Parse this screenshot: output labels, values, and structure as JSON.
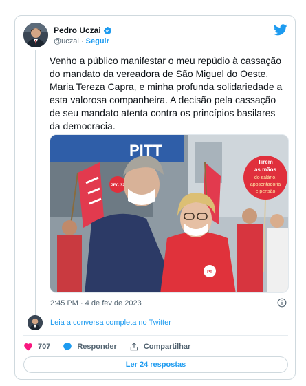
{
  "author": {
    "name": "Pedro Uczai",
    "handle": "@uczai",
    "follow_label": "Seguir",
    "separator": " · "
  },
  "tweet": {
    "text": "Venho a público manifestar o meu repúdio à cassação do mandato da vereadora de São Miguel do Oeste, Maria Tereza Capra, e minha profunda solidariedade a esta valorosa companheira. A decisão pela cassação de seu mandato atenta contra os princípios basilares da democracia.",
    "timestamp": "2:45 PM · 4 de fev de 2023"
  },
  "photo": {
    "sign_text": "PITT",
    "placard_lines": [
      "Tirem",
      "as mãos",
      "do salário,",
      "aposentadoria",
      "e pensão"
    ],
    "small_sign": "PEC 32",
    "badge": "PT"
  },
  "read_conversation": "Leia a conversa completa no Twitter",
  "actions": {
    "likes": "707",
    "reply_label": "Responder",
    "share_label": "Compartilhar"
  },
  "read_replies_label": "Ler 24 respostas",
  "colors": {
    "accent": "#1d9bf0",
    "like": "#f91880",
    "text": "#0f1419",
    "muted": "#536471",
    "border": "#cfd9de"
  },
  "icons": [
    "verified-badge-icon",
    "twitter-bird-icon",
    "info-icon",
    "heart-icon",
    "reply-bubble-icon",
    "share-icon"
  ]
}
